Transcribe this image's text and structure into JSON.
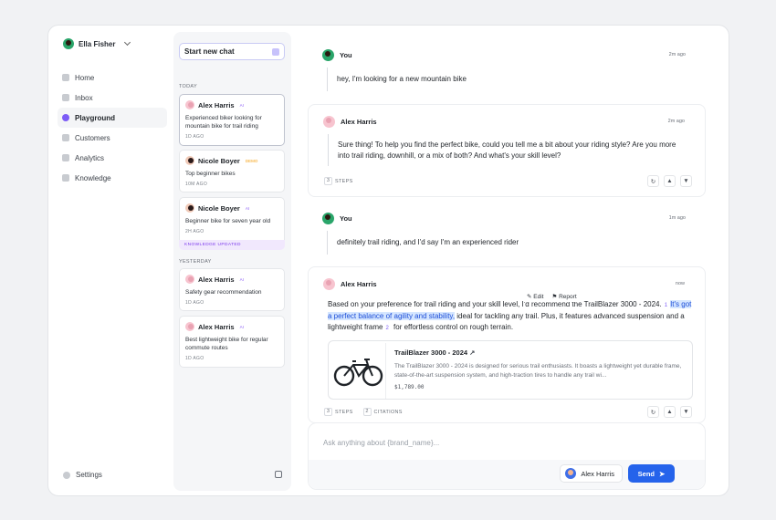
{
  "user": {
    "name": "Ella Fisher"
  },
  "nav": [
    {
      "label": "Home",
      "icon": "home-icon"
    },
    {
      "label": "Inbox",
      "icon": "inbox-icon"
    },
    {
      "label": "Playground",
      "icon": "sparkle-icon",
      "active": true
    },
    {
      "label": "Customers",
      "icon": "users-icon"
    },
    {
      "label": "Analytics",
      "icon": "chart-icon"
    },
    {
      "label": "Knowledge",
      "icon": "book-icon"
    }
  ],
  "settings_label": "Settings",
  "chatlist": {
    "new_chat_label": "Start new chat",
    "today_label": "TODAY",
    "yesterday_label": "YESTERDAY",
    "cards": [
      {
        "name": "Alex Harris",
        "tag": "AI",
        "text": "Experienced biker looking for mountain bike for trail riding",
        "time": "1D AGO"
      },
      {
        "name": "Nicole Boyer",
        "tag": "DEMO",
        "text": "Top beginner bikes",
        "time": "10M AGO"
      },
      {
        "name": "Nicole Boyer",
        "tag": "AI",
        "text": "Beginner bike for seven year old",
        "time": "2H AGO",
        "badge": "KNOWLEDGE UPDATED"
      },
      {
        "name": "Alex Harris",
        "tag": "AI",
        "text": "Safety gear recommendation",
        "time": "1D AGO"
      },
      {
        "name": "Alex Harris",
        "tag": "AI",
        "text": "Best lightweight bike for regular commute routes",
        "time": "1D AGO"
      }
    ]
  },
  "messages": [
    {
      "author": "You",
      "time": "2m ago",
      "text": "hey, I'm looking for a new mountain bike"
    },
    {
      "author": "Alex Harris",
      "time": "2m ago",
      "text": "Sure thing! To help you find the perfect bike, could you tell me a bit about your riding style? Are you more into trail riding, downhill, or a mix of both? And what's your skill level?",
      "steps": "3",
      "steps_label": "STEPS"
    },
    {
      "author": "You",
      "time": "1m ago",
      "text": "definitely trail riding, and I'd say I'm an experienced rider"
    },
    {
      "author": "Alex Harris",
      "time": "now",
      "answer_part1": "Based on your preference for trail riding and your skill level, I'd recommend the TrailBlazer 3000 - 2024.",
      "cite1": "1",
      "highlight": "It's got a perfect balance of agility and stability,",
      "answer_part2": " ideal for tackling any trail. Plus, it features advanced suspension and a lightweight frame",
      "cite2": "2",
      "answer_part3": " for effortless control on rough terrain.",
      "edit_label": "Edit",
      "report_label": "Report",
      "steps": "3",
      "steps_label": "STEPS",
      "citations": "2",
      "citations_label": "CITATIONS",
      "product": {
        "title": "TrailBlazer 3000 - 2024",
        "description": "The TrailBlazer 3000 - 2024 is designed for serious trail enthusiasts. It boasts a lightweight yet durable frame, state-of-the-art suspension system, and high-traction tires to handle any trail wi...",
        "price": "$1,789.00"
      }
    }
  ],
  "composer": {
    "placeholder": "Ask anything about {brand_name}...",
    "agent_name": "Alex Harris",
    "send_label": "Send"
  },
  "colors": {
    "accent": "#2563eb",
    "highlight": "#d5e6ff",
    "ai_tag": "#8b5cf6"
  }
}
